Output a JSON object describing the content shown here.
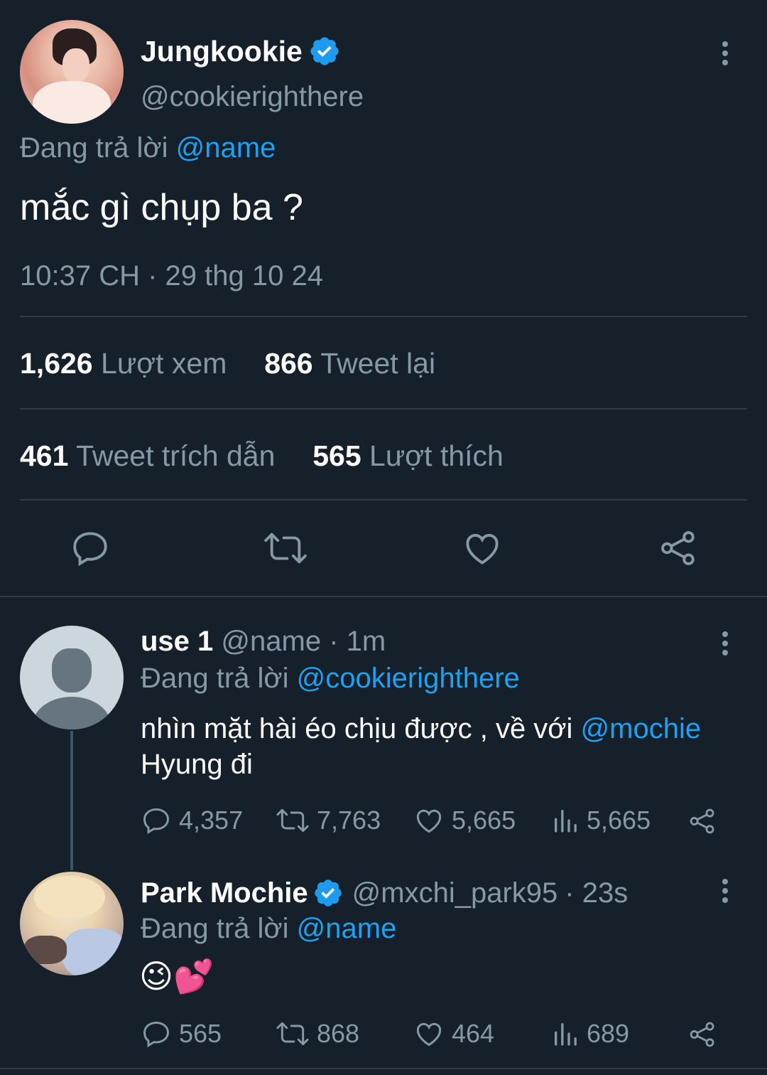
{
  "main_tweet": {
    "display_name": "Jungkookie",
    "handle": "@cookierighthere",
    "replying_prefix": "Đang trả lời",
    "replying_to": "@name",
    "text": "mắc gì chụp ba ?",
    "timestamp": "10:37 CH · 29 thg 10 24",
    "stats": {
      "views_count": "1,626",
      "views_label": "Lượt xem",
      "retweets_count": "866",
      "retweets_label": "Tweet lại",
      "quotes_count": "461",
      "quotes_label": "Tweet trích dẫn",
      "likes_count": "565",
      "likes_label": "Lượt thích"
    },
    "actions": [
      "reply-icon",
      "retweet-icon",
      "like-icon",
      "share-icon"
    ]
  },
  "replies": [
    {
      "display_name": "use 1",
      "handle": "@name",
      "time": "· 1m",
      "replying_prefix": "Đang trả lời",
      "replying_to": "@cookierighthere",
      "text_part1": "nhìn mặt hài éo chịu được  , về với",
      "mention": "@mochie",
      "text_part2": "Hyung đi",
      "replies": "4,357",
      "retweets": "7,763",
      "likes": "5,665",
      "views": "5,665"
    },
    {
      "display_name": "Park Mochie",
      "handle": "@mxchi_park95",
      "time": "· 23s",
      "replying_prefix": "Đang trả lời",
      "replying_to": "@name",
      "text": "😉💕",
      "replies": "565",
      "retweets": "868",
      "likes": "464",
      "views": "689"
    }
  ],
  "colors": {
    "background": "#15202b",
    "accent": "#1da1f2",
    "muted": "#8899a6",
    "divider": "#2f3b47"
  }
}
